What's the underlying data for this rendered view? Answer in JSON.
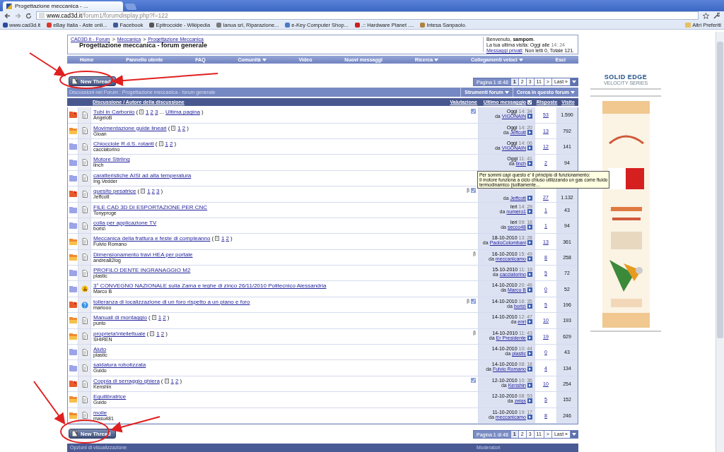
{
  "browser": {
    "tab": "Progettazione meccanica - ...",
    "url_domain": "www.cad3d.it",
    "url_path": "/forum1/forumdisplay.php?f=122",
    "bookmarks": [
      {
        "label": "www.cad3d.it",
        "color": "#2a4aa0"
      },
      {
        "label": "eBay Italia - Aste onli...",
        "color": "#d83a2a"
      },
      {
        "label": "Facebook",
        "color": "#3b5998"
      },
      {
        "label": "Epitrocoide - Wikipedia",
        "color": "#555555"
      },
      {
        "label": "Ianua srl, Riparazione...",
        "color": "#7a7a7a"
      },
      {
        "label": "e-Key Computer Shop...",
        "color": "#4a78c8"
      },
      {
        "label": ".:: Hardware Planet ....",
        "color": "#cc2020"
      },
      {
        "label": "Intesa Sanpaolo.",
        "color": "#b08040"
      }
    ],
    "other_bookmarks": "Altri Preferiti"
  },
  "header": {
    "breadcrumb": [
      "CAD3D.it - Forum",
      "Meccanica",
      "Progettazione Meccanica"
    ],
    "separators": [
      ">",
      ">"
    ],
    "title": "Progettazione meccanica - forum generale",
    "welcome": "Benvenuto, **sampom**.",
    "last_visit": "La tua ultima visita: Oggi alle",
    "last_visit_time": "14: 24",
    "messages_link": "Messaggi privati",
    "messages_text": ": Non letti 0, Totale 121."
  },
  "nav": [
    {
      "label": "Home",
      "dropdown": false
    },
    {
      "label": "Pannello utente",
      "dropdown": false
    },
    {
      "label": "FAQ",
      "dropdown": false
    },
    {
      "label": "Comunità",
      "dropdown": true
    },
    {
      "label": "Video",
      "dropdown": false
    },
    {
      "label": "Nuovi messaggi",
      "dropdown": false
    },
    {
      "label": "Ricerca",
      "dropdown": true
    },
    {
      "label": "Collegamenti veloci",
      "dropdown": true
    },
    {
      "label": "Esci",
      "dropdown": false
    }
  ],
  "top_controls": {
    "new_thread": "New Thread",
    "pagination": {
      "label": "Pagina 1 di 48",
      "pages": [
        {
          "label": "1",
          "selected": true
        },
        {
          "label": "2",
          "selected": false
        },
        {
          "label": "3",
          "selected": false
        },
        {
          "label": "11",
          "selected": false
        },
        {
          "label": ">",
          "selected": false
        },
        {
          "label": "Last »",
          "selected": false
        }
      ]
    }
  },
  "forum_bar": {
    "title": "Discussioni nel Forum : Progettazione meccanica - forum generale",
    "tools": [
      {
        "label": "Strumenti forum"
      },
      {
        "label": "Cerca in questo forum"
      }
    ]
  },
  "columns": {
    "thread": "Discussione",
    "sep": "/",
    "author": "Autore della discussione",
    "rating": "Valutazione",
    "last": "Ultimo messaggio",
    "replies": "Risposte",
    "views": "Visite"
  },
  "rows": [
    {
      "status": {
        "kind": "hot"
      },
      "post_icon": {
        "kind": "page"
      },
      "title": "Tubi in Carbonio",
      "pages": {
        "open": "(",
        "links": [
          "1",
          "2",
          "3"
        ],
        "more": "...",
        "last": "Ultima pagina",
        "close": ")"
      },
      "author": "AngeloB",
      "attachment": false,
      "rated": true,
      "date": "Oggi",
      "time": "14: 34",
      "by_label": "da",
      "by": "VIGONAIN",
      "replies": "53",
      "views": "1.590"
    },
    {
      "status": {
        "kind": "popular"
      },
      "post_icon": {
        "kind": "page"
      },
      "title": "Movimentazione guide lineari",
      "pages": {
        "open": "(",
        "links": [
          "1",
          "2"
        ],
        "close": ")"
      },
      "author": "Gioan",
      "attachment": false,
      "rated": false,
      "date": "Oggi",
      "time": "14: 20",
      "by_label": "da",
      "by": "Jeffcott",
      "replies": "13",
      "views": "792"
    },
    {
      "status": {
        "kind": "normal"
      },
      "post_icon": {
        "kind": "page"
      },
      "title": "Chiocciole R.d.S. rotanti",
      "pages": {
        "open": "(",
        "links": [
          "1",
          "2"
        ],
        "close": ")"
      },
      "author": "cacciatorino",
      "attachment": false,
      "rated": false,
      "date": "Oggi",
      "time": "14: 06",
      "by_label": "da",
      "by": "VIGONAIN",
      "replies": "12",
      "views": "141"
    },
    {
      "status": {
        "kind": "normal"
      },
      "post_icon": {
        "kind": "page"
      },
      "title": "Motore Stirling",
      "author": "linch",
      "attachment": false,
      "rated": false,
      "date": "Oggi",
      "time": "11: 41",
      "by_label": "da",
      "by": "linch",
      "replies": "2",
      "views": "94"
    },
    {
      "status": {
        "kind": "normal"
      },
      "post_icon": {
        "kind": "page"
      },
      "title": "caratteristiche AISI ad alta temperatura",
      "author": "Ing.Vedder",
      "attachment": false,
      "rated": false,
      "tooltip": [
        "Per sommi capi questo e' il principio di funzionamento:",
        "Il motore funziona a ciclo chiuso utilizzando un gas come fluido",
        "termodinamico (solitamente..."
      ]
    },
    {
      "status": {
        "kind": "hot"
      },
      "post_icon": {
        "kind": "page"
      },
      "title": "quesito pesatrice",
      "pages": {
        "open": "(",
        "links": [
          "1",
          "2",
          "3"
        ],
        "close": ")"
      },
      "author": "Jeffcott",
      "attachment": true,
      "rated": true,
      "by_label": "da",
      "by": "Jeffcott",
      "replies": "27",
      "views": "1.132"
    },
    {
      "status": {
        "kind": "normal"
      },
      "post_icon": {
        "kind": "page"
      },
      "title": "FILE CAD 3D DI ESPORTAZIONE PER CNC",
      "author": "Tonyproge",
      "attachment": false,
      "rated": false,
      "date": "Ieri",
      "time": "14: 29",
      "by_label": "da",
      "by": "numero1",
      "replies": "1",
      "views": "43"
    },
    {
      "status": {
        "kind": "normal"
      },
      "post_icon": {
        "kind": "page"
      },
      "title": "colla per applicazione TV",
      "author": "boris\\",
      "attachment": false,
      "rated": false,
      "date": "Ieri",
      "time": "09: 18",
      "by_label": "da",
      "by": "secco48",
      "replies": "1",
      "views": "94"
    },
    {
      "status": {
        "kind": "popular"
      },
      "post_icon": {
        "kind": "page"
      },
      "title": "Meccanica della frattura e feste di compleanno",
      "pages": {
        "open": "(",
        "links": [
          "1",
          "2"
        ],
        "close": ")"
      },
      "author": "Fulvio Romano",
      "attachment": false,
      "rated": false,
      "date": "18-10-2010",
      "time": "13: 28",
      "by_label": "da",
      "by": "PaoloColombani",
      "replies": "13",
      "views": "361"
    },
    {
      "status": {
        "kind": "popular"
      },
      "post_icon": {
        "kind": "page"
      },
      "title": "Dimensionamento travi HEA per portale",
      "author": "andrea82log",
      "attachment": true,
      "rated": false,
      "date": "16-10-2010",
      "time": "15: 49",
      "by_label": "da",
      "by": "meccanicamo",
      "replies": "8",
      "views": "258"
    },
    {
      "status": {
        "kind": "normal"
      },
      "post_icon": {
        "kind": "page"
      },
      "title": "PROFILO DENTE INGRANAGGIO M2",
      "author": "plastic",
      "attachment": false,
      "rated": false,
      "date": "15-10-2010",
      "time": "11: 19",
      "by_label": "da",
      "by": "cacciatorino",
      "replies": "5",
      "views": "72"
    },
    {
      "status": {
        "kind": "normal"
      },
      "post_icon": {
        "kind": "thumb"
      },
      "title": "3° CONVEGNO NAZIONALE sulla Zama e leghe di zinco 26/11/2010 Politecnico Alessandria",
      "author": "Marco B",
      "attachment": false,
      "rated": false,
      "date": "14-10-2010",
      "time": "20: 46",
      "by_label": "da",
      "by": "Marco B",
      "replies": "0",
      "views": "52"
    },
    {
      "status": {
        "kind": "hot"
      },
      "post_icon": {
        "kind": "question"
      },
      "title": "tolleranza di localizzazione di un foro rispetto a un piano e foro",
      "author": "mariooo",
      "attachment": true,
      "rated": true,
      "date": "14-10-2010",
      "time": "16: 35",
      "by_label": "da",
      "by": "boris\\",
      "replies": "5",
      "views": "196"
    },
    {
      "status": {
        "kind": "popular"
      },
      "post_icon": {
        "kind": "page"
      },
      "title": "Manuali di montaggio",
      "pages": {
        "open": "(",
        "links": [
          "1",
          "2"
        ],
        "close": ")"
      },
      "author": "punto",
      "attachment": false,
      "rated": false,
      "date": "14-10-2010",
      "time": "12: 47",
      "by_label": "da",
      "by": "enri",
      "replies": "10",
      "views": "193"
    },
    {
      "status": {
        "kind": "popular"
      },
      "post_icon": {
        "kind": "page"
      },
      "title": "proprieta'intellettuale",
      "pages": {
        "open": "(",
        "links": [
          "1",
          "2"
        ],
        "close": ")"
      },
      "author": "SHIREN",
      "attachment": true,
      "rated": false,
      "date": "14-10-2010",
      "time": "11: 43",
      "by_label": "da",
      "by": "Er Presidente",
      "replies": "19",
      "views": "629"
    },
    {
      "status": {
        "kind": "normal"
      },
      "post_icon": {
        "kind": "page"
      },
      "title": "Aiuto",
      "author": "plastic",
      "attachment": false,
      "rated": false,
      "date": "14-10-2010",
      "time": "10: 44",
      "by_label": "da",
      "by": "plastic",
      "replies": "0",
      "views": "43"
    },
    {
      "status": {
        "kind": "normal"
      },
      "post_icon": {
        "kind": "page"
      },
      "title": "saldatura robotizzata",
      "author": "Guido",
      "attachment": false,
      "rated": false,
      "date": "14-10-2010",
      "time": "08: 18",
      "by_label": "da",
      "by": "Fulvio Romano",
      "replies": "4",
      "views": "134"
    },
    {
      "status": {
        "kind": "hot"
      },
      "post_icon": {
        "kind": "page"
      },
      "title": "Coppia di serraggio ghiera",
      "pages": {
        "open": "(",
        "links": [
          "1",
          "2"
        ],
        "close": ")"
      },
      "author": "Kenshin",
      "attachment": false,
      "rated": true,
      "date": "12-10-2010",
      "time": "10: 36",
      "by_label": "da",
      "by": "Kenshin",
      "replies": "10",
      "views": "254"
    },
    {
      "status": {
        "kind": "popular"
      },
      "post_icon": {
        "kind": "page"
      },
      "title": "Equilibratrice",
      "author": "Guido",
      "attachment": false,
      "rated": false,
      "date": "12-10-2010",
      "time": "08: 53",
      "by_label": "da",
      "by": "zeigs",
      "replies": "5",
      "views": "152"
    },
    {
      "status": {
        "kind": "popular"
      },
      "post_icon": {
        "kind": "page"
      },
      "title": "molle",
      "author": "masu481",
      "attachment": false,
      "rated": false,
      "date": "11-10-2010",
      "time": "19: 17",
      "by_label": "da",
      "by": "meccanicamo",
      "replies": "8",
      "views": "246"
    }
  ],
  "bottom_controls": {
    "new_thread": "New Thread",
    "pagination": {
      "label": "Pagina 1 di 48",
      "pages": [
        {
          "label": "1",
          "selected": true
        },
        {
          "label": "2",
          "selected": false
        },
        {
          "label": "3",
          "selected": false
        },
        {
          "label": "11",
          "selected": false
        },
        {
          "label": ">",
          "selected": false
        },
        {
          "label": "Last »",
          "selected": false
        }
      ]
    }
  },
  "footer": {
    "left": "Opzioni di visualizzazione",
    "right": "Moderatori"
  },
  "sidebar": {
    "logo_title": "SOLID EDGE",
    "logo_subtitle": "VELOCITY SERIES"
  }
}
